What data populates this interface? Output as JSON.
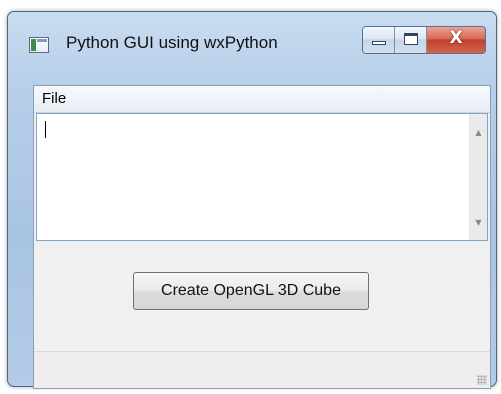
{
  "window": {
    "title": "Python GUI using wxPython",
    "close_glyph": "X",
    "icons": {
      "app": "window-app-icon",
      "minimize": "minimize-icon",
      "maximize": "maximize-icon",
      "close": "close-icon",
      "scroll_up": "chevron-up-icon",
      "scroll_down": "chevron-down-icon",
      "grip": "resize-grip-icon"
    },
    "colors": {
      "close_button": "#c3402b",
      "frame": "#a9c4e3",
      "client": "#f0f0f0"
    }
  },
  "menubar": {
    "items": [
      {
        "label": "File"
      }
    ]
  },
  "editor": {
    "value": ""
  },
  "scrollbar": {
    "up_glyph": "▲",
    "down_glyph": "▼"
  },
  "button": {
    "label": "Create OpenGL 3D Cube"
  },
  "statusbar": {
    "text": ""
  }
}
